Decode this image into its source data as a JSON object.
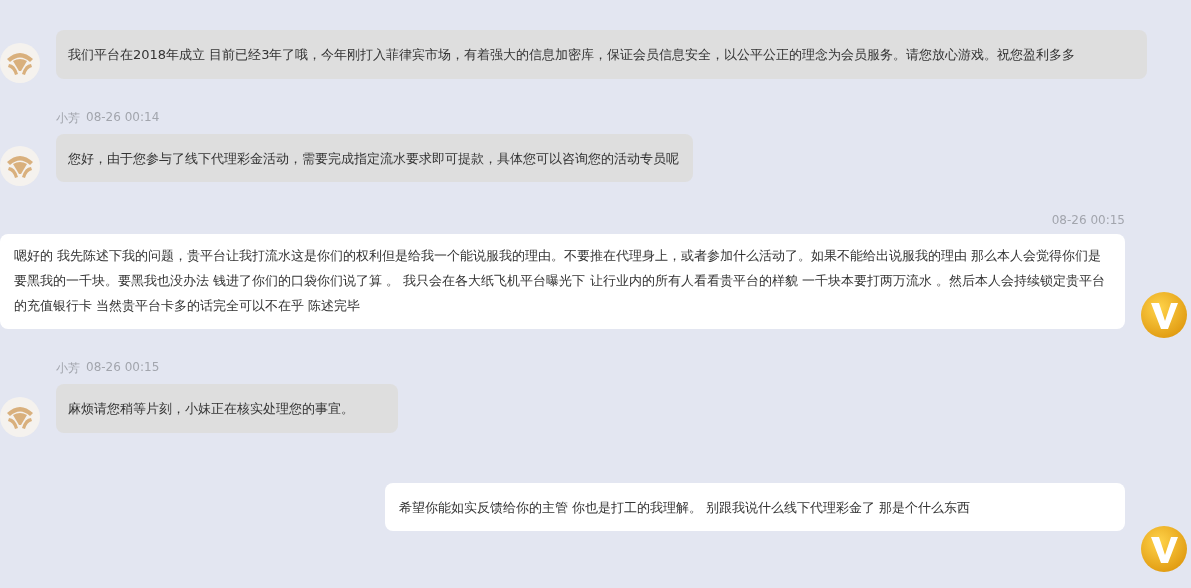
{
  "messages": [
    {
      "kind": "agent",
      "text": "我们平台在2018年成立 目前已经3年了哦，今年刚打入菲律宾市场，有着强大的信息加密库，保证会员信息安全，以公平公正的理念为会员服务。请您放心游戏。祝您盈利多多"
    },
    {
      "kind": "agent",
      "sender": "小芳",
      "time": "08-26 00:14",
      "text": "您好，由于您参与了线下代理彩金活动，需要完成指定流水要求即可提款，具体您可以咨询您的活动专员呢"
    },
    {
      "kind": "user",
      "time": "08-26 00:15",
      "text": "嗯好的 我先陈述下我的问题，贵平台让我打流水这是你们的权利但是给我一个能说服我的理由。不要推在代理身上，或者参加什么活动了。如果不能给出说服我的理由 那么本人会觉得你们是要黑我的一千块。要黑我也没办法 钱进了你们的口袋你们说了算 。 我只会在各大纸飞机平台曝光下 让行业内的所有人看看贵平台的样貌  一千块本要打两万流水 。然后本人会持续锁定贵平台的充值银行卡 当然贵平台卡多的话完全可以不在乎 陈述完毕"
    },
    {
      "kind": "agent",
      "sender": "小芳",
      "time": "08-26 00:15",
      "text": "麻烦请您稍等片刻，小妹正在核实处理您的事宜。"
    },
    {
      "kind": "user",
      "text": "希望你能如实反馈给你的主管 你也是打工的我理解。  别跟我说什么线下代理彩金了 那是个什么东西"
    }
  ]
}
